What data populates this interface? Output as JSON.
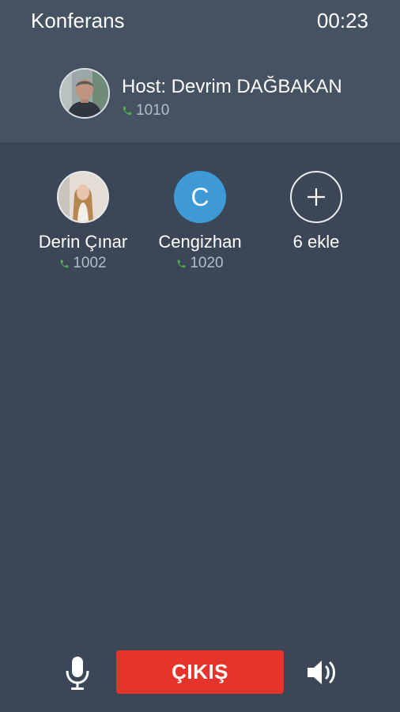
{
  "header": {
    "title": "Konferans",
    "timer": "00:23",
    "host": {
      "name": "Host: Devrim DAĞBAKAN",
      "extension": "1010",
      "avatar": "photo"
    }
  },
  "participants": [
    {
      "name": "Derin Çınar",
      "extension": "1002",
      "avatar": "photo"
    },
    {
      "name": "Cengizhan",
      "extension": "1020",
      "avatar_letter": "C"
    }
  ],
  "add_participant": {
    "label": "6 ekle",
    "icon": "plus-icon"
  },
  "controls": {
    "mic_icon": "microphone-icon",
    "exit_label": "ÇIKIŞ",
    "speaker_icon": "speaker-icon"
  },
  "colors": {
    "background": "#3b4756",
    "header_background": "#455262",
    "exit_button": "#e5352b",
    "letter_avatar": "#3d9ad6",
    "phone_icon": "#4caf50",
    "extension_text": "#b4bcc6"
  }
}
